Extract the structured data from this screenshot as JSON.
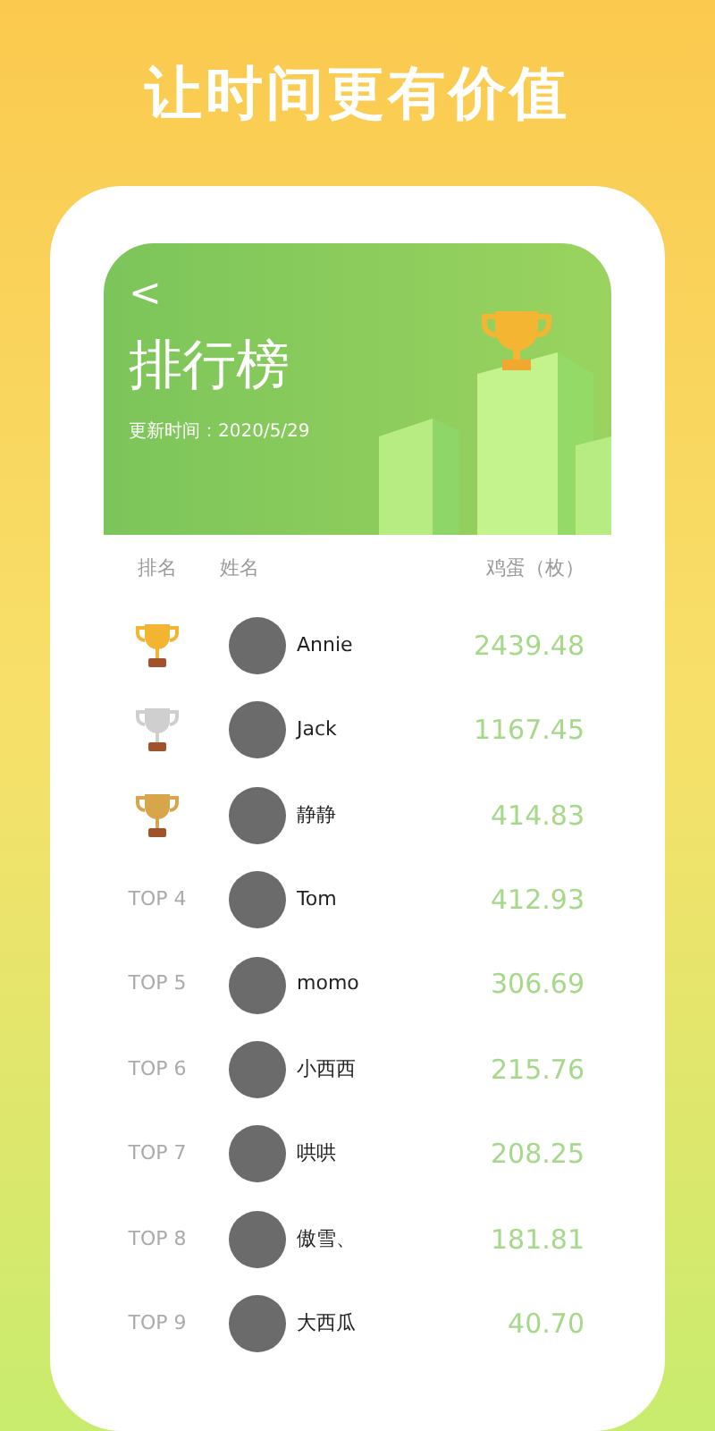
{
  "headline": "让时间更有价值",
  "header": {
    "back": "<",
    "title": "排行榜",
    "updated": "更新时间：2020/5/29"
  },
  "columns": [
    "排名",
    "姓名",
    "鸡蛋（枚）"
  ],
  "rows": [
    {
      "rank": {
        "kind": "trophy",
        "color": "#f2b431"
      },
      "name": "Annie",
      "value": "2439.48"
    },
    {
      "rank": {
        "kind": "trophy",
        "color": "#cfcfcf"
      },
      "name": "Jack",
      "value": "1167.45"
    },
    {
      "rank": {
        "kind": "trophy",
        "color": "#d9a54a"
      },
      "name": "静静",
      "value": "414.83"
    },
    {
      "rank": {
        "kind": "text",
        "label": "TOP 4"
      },
      "name": "Tom",
      "value": "412.93"
    },
    {
      "rank": {
        "kind": "text",
        "label": "TOP 5"
      },
      "name": "momo",
      "value": "306.69"
    },
    {
      "rank": {
        "kind": "text",
        "label": "TOP 6"
      },
      "name": "小西西",
      "value": "215.76"
    },
    {
      "rank": {
        "kind": "text",
        "label": "TOP 7"
      },
      "name": "哄哄",
      "value": "208.25"
    },
    {
      "rank": {
        "kind": "text",
        "label": "TOP 8"
      },
      "name": "傲雪、",
      "value": "181.81"
    },
    {
      "rank": {
        "kind": "text",
        "label": "TOP 9"
      },
      "name": "大西瓜",
      "value": "40.70"
    }
  ]
}
